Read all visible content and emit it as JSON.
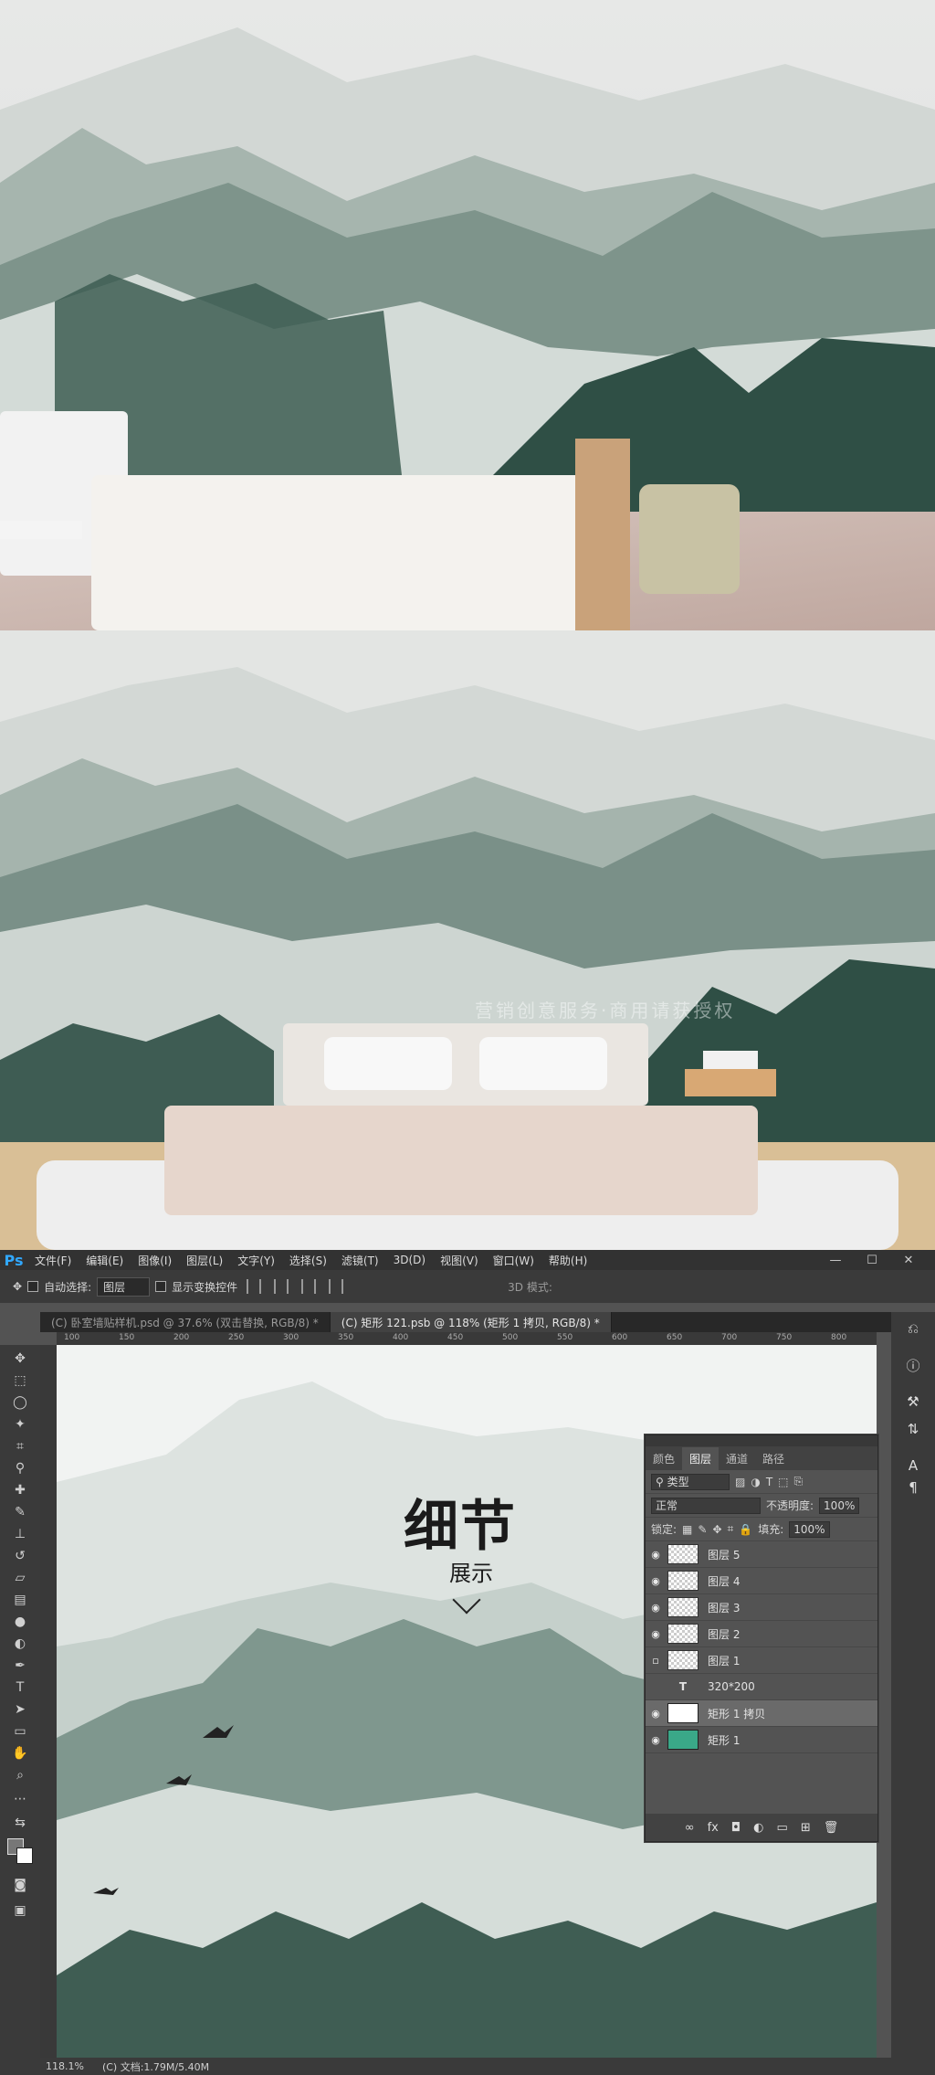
{
  "app": {
    "logo": "Ps"
  },
  "menu": [
    "文件(F)",
    "编辑(E)",
    "图像(I)",
    "图层(L)",
    "文字(Y)",
    "选择(S)",
    "滤镜(T)",
    "3D(D)",
    "视图(V)",
    "窗口(W)",
    "帮助(H)"
  ],
  "window_controls": {
    "minimize": "—",
    "restore": "☐",
    "close": "✕"
  },
  "options": {
    "auto_select_label": "自动选择:",
    "auto_select_value": "图层",
    "show_transform_label": "显示变换控件",
    "mode_3d_label": "3D 模式:"
  },
  "tabs": [
    {
      "label": "(C) 卧室墙贴样机.psd @ 37.6% (双击替换, RGB/8) *"
    },
    {
      "label": "(C) 矩形 121.psb @ 118% (矩形 1 拷贝, RGB/8) *"
    }
  ],
  "ruler_ticks": [
    "100",
    "150",
    "200",
    "250",
    "300",
    "350",
    "400",
    "450",
    "500",
    "550",
    "600",
    "650",
    "700",
    "750",
    "800"
  ],
  "canvas": {
    "title": "细节",
    "subtitle": "展示"
  },
  "watermark": "营销创意服务·商用请获授权",
  "layers_panel": {
    "tabs": [
      "颜色",
      "图层",
      "通道",
      "路径"
    ],
    "filter_label": "类型",
    "blend_mode": "正常",
    "opacity_label": "不透明度:",
    "opacity_value": "100%",
    "lock_label": "锁定:",
    "fill_label": "填充:",
    "fill_value": "100%",
    "layers": [
      {
        "name": "图层 5",
        "visible": true
      },
      {
        "name": "图层 4",
        "visible": true
      },
      {
        "name": "图层 3",
        "visible": true
      },
      {
        "name": "图层 2",
        "visible": true
      },
      {
        "name": "图层 1",
        "visible": false
      },
      {
        "name": "320*200",
        "visible": false
      },
      {
        "name": "矩形 1 拷贝",
        "visible": true
      },
      {
        "name": "矩形 1",
        "visible": true
      }
    ]
  },
  "status": {
    "zoom": "118.1%",
    "doc": "(C) 文档:1.79M/5.40M"
  },
  "colors": {
    "accent": "#31a8ff",
    "ink_green": "#2f4f45",
    "mist": "#e6ebe8"
  }
}
